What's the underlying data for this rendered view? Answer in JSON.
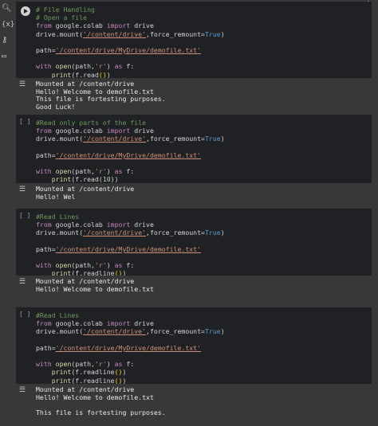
{
  "sidebar": {
    "icons": [
      "search-icon",
      "variables-icon",
      "key-icon",
      "folder-icon"
    ]
  },
  "toolbar": {
    "icons": [
      "arrow-up-icon",
      "arrow-down-icon",
      "link-icon",
      "comment-icon",
      "settings-icon",
      "mirror-icon",
      "delete-icon",
      "more-icon"
    ]
  },
  "cells": [
    {
      "gutter": "",
      "code": [
        {
          "parts": [
            [
              "cmt",
              "# File Handling"
            ]
          ]
        },
        {
          "parts": [
            [
              "cmt",
              "# Open a file"
            ]
          ]
        },
        {
          "parts": [
            [
              "kw",
              "from"
            ],
            [
              "",
              " google.colab "
            ],
            [
              "kw",
              "import"
            ],
            [
              "",
              " drive"
            ]
          ]
        },
        {
          "parts": [
            [
              "",
              "drive.mount("
            ],
            [
              "str",
              "'/content/drive'"
            ],
            [
              "",
              ",force_remount="
            ],
            [
              "bool",
              "True"
            ],
            [
              "",
              ")"
            ]
          ]
        },
        {
          "parts": [
            [
              "",
              ""
            ]
          ]
        },
        {
          "parts": [
            [
              "",
              "path="
            ],
            [
              "str",
              "'/content/drive/MyDrive/demofile.txt'"
            ]
          ]
        },
        {
          "parts": [
            [
              "",
              ""
            ]
          ]
        },
        {
          "parts": [
            [
              "kw",
              "with"
            ],
            [
              "",
              " "
            ],
            [
              "fn",
              "open"
            ],
            [
              "",
              "(path,"
            ],
            [
              "strp",
              "'r'"
            ],
            [
              "",
              ") "
            ],
            [
              "kw",
              "as"
            ],
            [
              "",
              " f:"
            ]
          ]
        },
        {
          "parts": [
            [
              "",
              "    "
            ],
            [
              "fn",
              "print"
            ],
            [
              "",
              "(f.read"
            ],
            [
              "par",
              "()"
            ],
            [
              "",
              ")"
            ]
          ]
        }
      ],
      "output": [
        "Mounted at /content/drive",
        "Hello! Welcome to demofile.txt",
        "This file is fortesting purposes.",
        "Good Luck!"
      ]
    },
    {
      "gutter": "[ ]",
      "code": [
        {
          "parts": [
            [
              "cmt",
              "#Read only parts of the file"
            ]
          ]
        },
        {
          "parts": [
            [
              "kw",
              "from"
            ],
            [
              "",
              " google.colab "
            ],
            [
              "kw",
              "import"
            ],
            [
              "",
              " drive"
            ]
          ]
        },
        {
          "parts": [
            [
              "",
              "drive.mount("
            ],
            [
              "str",
              "'/content/drive'"
            ],
            [
              "",
              ",force_remount="
            ],
            [
              "bool",
              "True"
            ],
            [
              "",
              ")"
            ]
          ]
        },
        {
          "parts": [
            [
              "",
              ""
            ]
          ]
        },
        {
          "parts": [
            [
              "",
              "path="
            ],
            [
              "str",
              "'/content/drive/MyDrive/demofile.txt'"
            ]
          ]
        },
        {
          "parts": [
            [
              "",
              ""
            ]
          ]
        },
        {
          "parts": [
            [
              "kw",
              "with"
            ],
            [
              "",
              " "
            ],
            [
              "fn",
              "open"
            ],
            [
              "",
              "(path,"
            ],
            [
              "strp",
              "'r'"
            ],
            [
              "",
              ") "
            ],
            [
              "kw",
              "as"
            ],
            [
              "",
              " f:"
            ]
          ]
        },
        {
          "parts": [
            [
              "",
              "    "
            ],
            [
              "fn",
              "print"
            ],
            [
              "",
              "(f.read("
            ],
            [
              "num",
              "10"
            ],
            [
              "",
              "))"
            ]
          ]
        }
      ],
      "output": [
        "Mounted at /content/drive",
        "Hello! Wel"
      ]
    },
    {
      "gutter": "[ ]",
      "code": [
        {
          "parts": [
            [
              "cmt",
              "#Read Lines"
            ]
          ]
        },
        {
          "parts": [
            [
              "kw",
              "from"
            ],
            [
              "",
              " google.colab "
            ],
            [
              "kw",
              "import"
            ],
            [
              "",
              " drive"
            ]
          ]
        },
        {
          "parts": [
            [
              "",
              "drive.mount("
            ],
            [
              "str",
              "'/content/drive'"
            ],
            [
              "",
              ",force_remount="
            ],
            [
              "bool",
              "True"
            ],
            [
              "",
              ")"
            ]
          ]
        },
        {
          "parts": [
            [
              "",
              ""
            ]
          ]
        },
        {
          "parts": [
            [
              "",
              "path="
            ],
            [
              "str",
              "'/content/drive/MyDrive/demofile.txt'"
            ]
          ]
        },
        {
          "parts": [
            [
              "",
              ""
            ]
          ]
        },
        {
          "parts": [
            [
              "kw",
              "with"
            ],
            [
              "",
              " "
            ],
            [
              "fn",
              "open"
            ],
            [
              "",
              "(path,"
            ],
            [
              "strp",
              "'r'"
            ],
            [
              "",
              ") "
            ],
            [
              "kw",
              "as"
            ],
            [
              "",
              " f:"
            ]
          ]
        },
        {
          "parts": [
            [
              "",
              "    "
            ],
            [
              "fn",
              "print"
            ],
            [
              "",
              "(f.readline"
            ],
            [
              "par",
              "()"
            ],
            [
              "",
              ")"
            ]
          ]
        }
      ],
      "output": [
        "Mounted at /content/drive",
        "Hello! Welcome to demofile.txt"
      ]
    },
    {
      "gutter": "[ ]",
      "code": [
        {
          "parts": [
            [
              "cmt",
              "#Read Lines"
            ]
          ]
        },
        {
          "parts": [
            [
              "kw",
              "from"
            ],
            [
              "",
              " google.colab "
            ],
            [
              "kw",
              "import"
            ],
            [
              "",
              " drive"
            ]
          ]
        },
        {
          "parts": [
            [
              "",
              "drive.mount("
            ],
            [
              "str",
              "'/content/drive'"
            ],
            [
              "",
              ",force_remount="
            ],
            [
              "bool",
              "True"
            ],
            [
              "",
              ")"
            ]
          ]
        },
        {
          "parts": [
            [
              "",
              ""
            ]
          ]
        },
        {
          "parts": [
            [
              "",
              "path="
            ],
            [
              "str",
              "'/content/drive/MyDrive/demofile.txt'"
            ]
          ]
        },
        {
          "parts": [
            [
              "",
              ""
            ]
          ]
        },
        {
          "parts": [
            [
              "kw",
              "with"
            ],
            [
              "",
              " "
            ],
            [
              "fn",
              "open"
            ],
            [
              "",
              "(path,"
            ],
            [
              "strp",
              "'r'"
            ],
            [
              "",
              ") "
            ],
            [
              "kw",
              "as"
            ],
            [
              "",
              " f:"
            ]
          ]
        },
        {
          "parts": [
            [
              "",
              "    "
            ],
            [
              "fn",
              "print"
            ],
            [
              "",
              "(f.readline"
            ],
            [
              "par",
              "()"
            ],
            [
              "",
              ")"
            ]
          ]
        },
        {
          "parts": [
            [
              "",
              "    "
            ],
            [
              "fn",
              "print"
            ],
            [
              "",
              "(f.readline"
            ],
            [
              "par",
              "()"
            ],
            [
              "",
              ")"
            ]
          ]
        }
      ],
      "output": [
        "Mounted at /content/drive",
        "Hello! Welcome to demofile.txt",
        "",
        "This file is fortesting purposes."
      ]
    }
  ]
}
